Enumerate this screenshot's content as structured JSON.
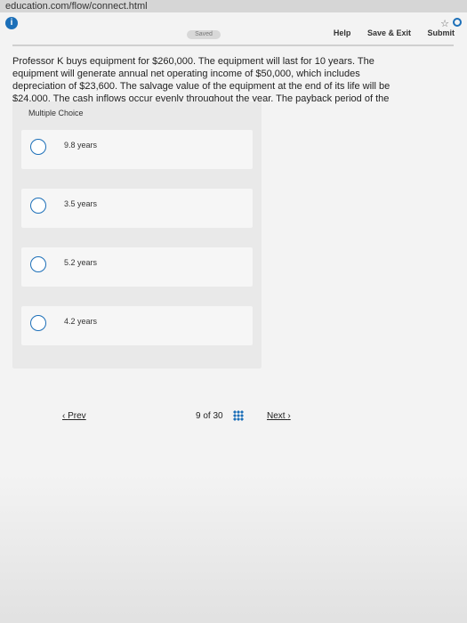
{
  "browser": {
    "url": "education.com/flow/connect.html"
  },
  "header": {
    "saved_label": "Saved",
    "help_label": "Help",
    "save_exit_label": "Save & Exit",
    "submit_label": "Submit"
  },
  "question": {
    "text": "Professor K buys equipment for $260,000. The equipment will last for 10 years. The equipment will generate annual net operating income of $50,000, which includes depreciation of $23,600. The salvage value of the equipment at the end of its life will be $24,000. The cash inflows occur evenly throughout the year. The payback period of the equipment is closest to"
  },
  "multiple_choice": {
    "title": "Multiple Choice",
    "options": [
      {
        "label": "9.8 years"
      },
      {
        "label": "3.5 years"
      },
      {
        "label": "5.2 years"
      },
      {
        "label": "4.2 years"
      }
    ]
  },
  "pager": {
    "prev_label": "Prev",
    "current": "9",
    "of_label": "of",
    "total": "30",
    "next_label": "Next"
  },
  "icons": {
    "info": "info-icon",
    "star": "star-icon",
    "reload": "reload-icon",
    "grid": "grid-icon",
    "prev_chevron": "chevron-left-icon",
    "next_chevron": "chevron-right-icon"
  },
  "colors": {
    "accent": "#1c6fb8"
  }
}
